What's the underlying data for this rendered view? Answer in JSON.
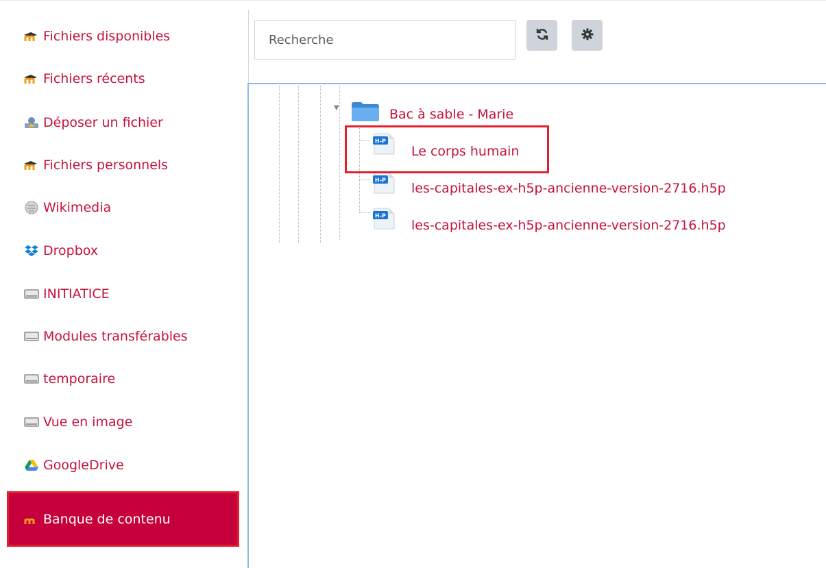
{
  "sidebar": {
    "items": [
      {
        "label": "Fichiers disponibles",
        "icon": "moodle-icon"
      },
      {
        "label": "Fichiers récents",
        "icon": "moodle-icon"
      },
      {
        "label": "Déposer un fichier",
        "icon": "upload-icon"
      },
      {
        "label": "Fichiers personnels",
        "icon": "moodle-icon"
      },
      {
        "label": "Wikimedia",
        "icon": "wikimedia-icon"
      },
      {
        "label": "Dropbox",
        "icon": "dropbox-icon"
      },
      {
        "label": "INITIATICE",
        "icon": "drive-icon"
      },
      {
        "label": "Modules transférables",
        "icon": "drive-icon"
      },
      {
        "label": "temporaire",
        "icon": "drive-icon"
      },
      {
        "label": "Vue en image",
        "icon": "drive-icon"
      },
      {
        "label": "GoogleDrive",
        "icon": "googledrive-icon"
      },
      {
        "label": "Banque de contenu",
        "icon": "moodle-icon",
        "selected": true
      }
    ]
  },
  "search": {
    "placeholder": "Recherche"
  },
  "toolbar": {
    "refresh_icon": "refresh-icon",
    "settings_icon": "gear-icon"
  },
  "tree": {
    "folder": {
      "label": "Bac à sable - Marie",
      "icon": "folder-icon",
      "expanded": true
    },
    "files": [
      {
        "label": "Le corps humain",
        "icon": "h5p-icon",
        "highlighted": true
      },
      {
        "label": "les-capitales-ex-h5p-ancienne-version-2716.h5p",
        "icon": "h5p-icon"
      },
      {
        "label": "les-capitales-ex-h5p-ancienne-version-2716.h5p",
        "icon": "h5p-icon"
      }
    ]
  },
  "colors": {
    "link": "#c5123d",
    "selected_bg": "#c6003c",
    "highlight_border": "#e1202e",
    "panel_border": "#8eb7ea",
    "button_bg": "#ced4da"
  }
}
